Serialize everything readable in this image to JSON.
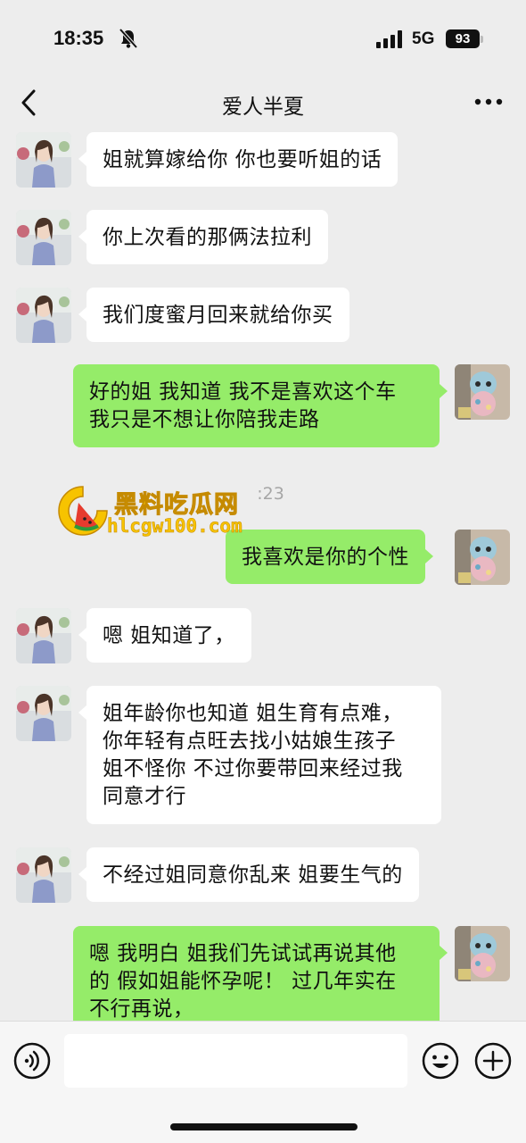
{
  "status_bar": {
    "time": "18:35",
    "network": "5G",
    "battery": "93"
  },
  "nav": {
    "title": "爱人半夏"
  },
  "messages": [
    {
      "side": "left",
      "lines": [
        "姐就算嫁给你 你也要听姐的话"
      ]
    },
    {
      "side": "left",
      "lines": [
        "你上次看的那俩法拉利"
      ]
    },
    {
      "side": "left",
      "lines": [
        "我们度蜜月回来就给你买"
      ]
    },
    {
      "side": "right",
      "lines": [
        "好的姐  我知道 我不是喜欢这个车",
        "我只是不想让你陪我走路"
      ]
    },
    {
      "side": "right",
      "lines": [
        "我喜欢是你的个性"
      ]
    },
    {
      "side": "left",
      "lines": [
        "嗯 姐知道了，"
      ]
    },
    {
      "side": "left",
      "lines": [
        "姐年龄你也知道 姐生育有点难，",
        "你年轻有点旺去找小姑娘生孩子",
        "姐不怪你 不过你要带回来经过我",
        "同意才行"
      ]
    },
    {
      "side": "left",
      "lines": [
        "不经过姐同意你乱来  姐要生气的"
      ]
    },
    {
      "side": "right",
      "lines": [
        "嗯 我明白  姐我们先试试再说其他",
        "的 假如姐能怀孕呢！ 过几年实在",
        "不行再说，"
      ]
    }
  ],
  "timestamp_partial": ":23",
  "watermark": {
    "name": "黑料吃瓜网",
    "url": "hlcgw100.com"
  },
  "colors": {
    "background": "#ededed",
    "bubble_right": "#95ec69",
    "bubble_left": "#ffffff",
    "watermark": "#f7c300"
  }
}
